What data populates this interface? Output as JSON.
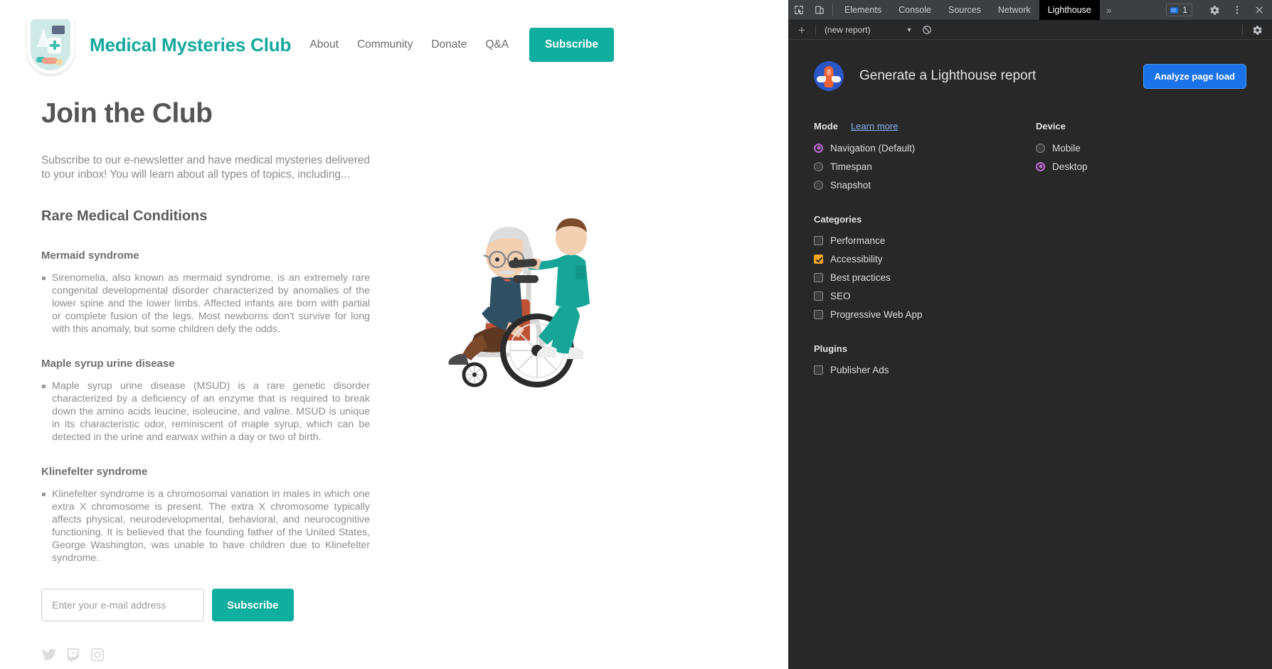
{
  "site": {
    "title": "Medical Mysteries Club",
    "logo_icon": "medical-shield-icon",
    "nav": [
      {
        "label": "About"
      },
      {
        "label": "Community"
      },
      {
        "label": "Donate"
      },
      {
        "label": "Q&A"
      }
    ],
    "nav_cta": "Subscribe"
  },
  "page": {
    "heading": "Join the Club",
    "lede": "Subscribe to our e-newsletter and have medical mysteries delivered to your inbox! You will learn about all types of topics, including...",
    "section_heading": "Rare Medical Conditions",
    "conditions": [
      {
        "title": "Mermaid syndrome",
        "body": "Sirenomelia, also known as mermaid syndrome, is an extremely rare congenital developmental disorder characterized by anomalies of the lower spine and the lower limbs. Affected infants are born with partial or complete fusion of the legs. Most newborns don't survive for long with this anomaly, but some children defy the odds."
      },
      {
        "title": "Maple syrup urine disease",
        "body": "Maple syrup urine disease (MSUD) is a rare genetic disorder characterized by a deficiency of an enzyme that is required to break down the amino acids leucine, isoleucine, and valine. MSUD is unique in its characteristic odor, reminiscent of maple syrup, which can be detected in the urine and earwax within a day or two of birth."
      },
      {
        "title": "Klinefelter syndrome",
        "body": "Klinefelter syndrome is a chromosomal variation in males in which one extra X chromosome is present. The extra X chromosome typically affects physical, neurodevelopmental, behavioral, and neurocognitive functioning. It is believed that the founding father of the United States, George Washington, was unable to have children due to Klinefelter syndrome."
      }
    ],
    "form": {
      "email_placeholder": "Enter your e-mail address",
      "email_value": "",
      "submit_label": "Subscribe"
    },
    "socials": [
      {
        "name": "twitter-icon"
      },
      {
        "name": "twitch-icon"
      },
      {
        "name": "instagram-icon"
      }
    ],
    "illustration": "caregiver-pushing-elderly-man-in-wheelchair"
  },
  "devtools": {
    "tabs": [
      {
        "label": "Elements",
        "active": false
      },
      {
        "label": "Console",
        "active": false
      },
      {
        "label": "Sources",
        "active": false
      },
      {
        "label": "Network",
        "active": false
      },
      {
        "label": "Lighthouse",
        "active": true
      }
    ],
    "more_tabs": "»",
    "issues_count": "1",
    "report_select": "(new report)",
    "lighthouse": {
      "title": "Generate a Lighthouse report",
      "analyze_button": "Analyze page load",
      "mode_label": "Mode",
      "learn_more": "Learn more",
      "modes": [
        {
          "label": "Navigation (Default)",
          "selected": true
        },
        {
          "label": "Timespan",
          "selected": false
        },
        {
          "label": "Snapshot",
          "selected": false
        }
      ],
      "device_label": "Device",
      "devices": [
        {
          "label": "Mobile",
          "selected": false
        },
        {
          "label": "Desktop",
          "selected": true
        }
      ],
      "categories_label": "Categories",
      "categories": [
        {
          "label": "Performance",
          "checked": false
        },
        {
          "label": "Accessibility",
          "checked": true
        },
        {
          "label": "Best practices",
          "checked": false
        },
        {
          "label": "SEO",
          "checked": false
        },
        {
          "label": "Progressive Web App",
          "checked": false
        }
      ],
      "plugins_label": "Plugins",
      "plugins": [
        {
          "label": "Publisher Ads",
          "checked": false
        }
      ]
    }
  },
  "colors": {
    "brand_teal": "#0fae9e",
    "accent_blue": "#1a73e8",
    "radio_selected": "#c06bd4",
    "checkbox_checked": "#f5a623",
    "link_blue": "#8ab4f8"
  }
}
